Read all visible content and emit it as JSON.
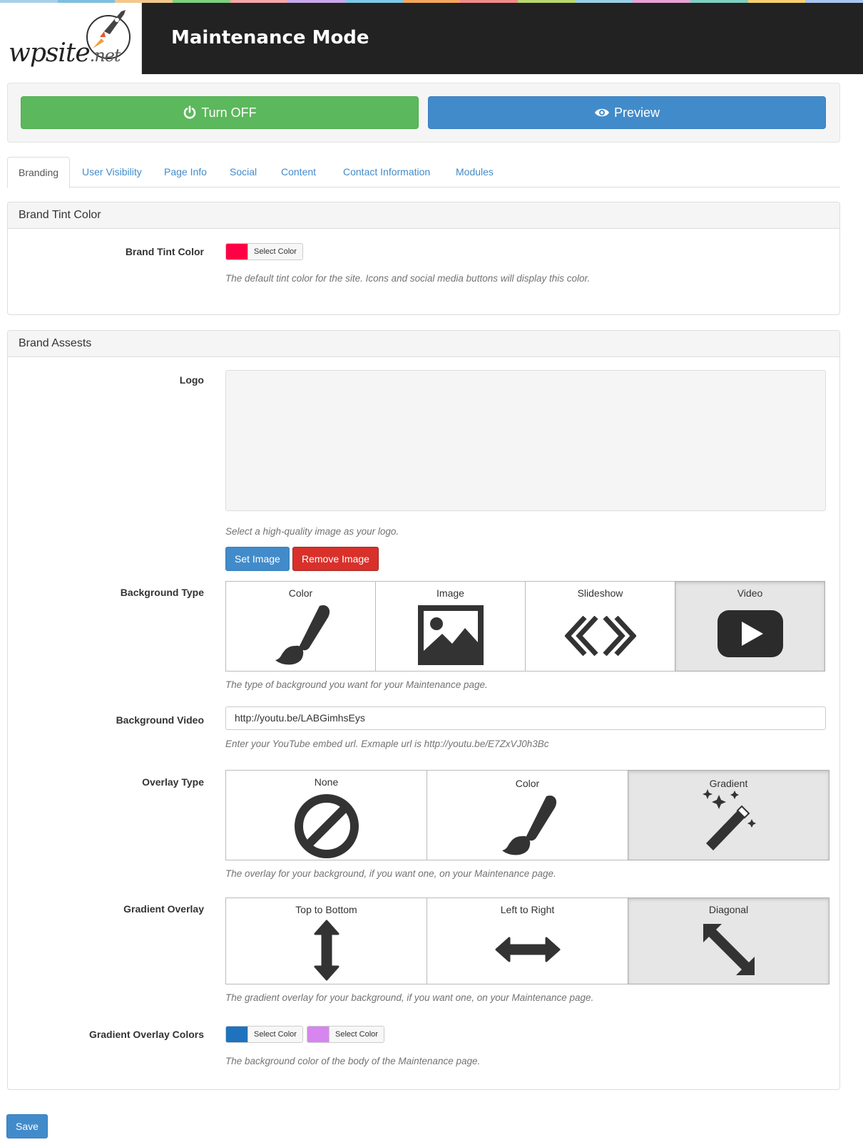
{
  "colors": {
    "rainbow": [
      "#a8d0e8",
      "#7ec0e0",
      "#f2c98a",
      "#7fd07f",
      "#f7a7a7",
      "#c9a8e8",
      "#7fc8e8",
      "#f5a65b",
      "#f28b8b",
      "#b9d86f",
      "#9ccfe6",
      "#e8a3d3",
      "#7fd0c0",
      "#f7d070",
      "#a9c6f0"
    ],
    "brand_tint": "#ff0044",
    "gradient_color_1": "#1e73be",
    "gradient_color_2": "#d686ee"
  },
  "header": {
    "logo_main": "wpsite",
    "logo_net": ".net",
    "title": "Maintenance Mode"
  },
  "actions": {
    "turn_off": "Turn OFF",
    "preview": "Preview",
    "turn_off_icon": "power-icon",
    "preview_icon": "eye-icon"
  },
  "tabs": [
    {
      "label": "Branding",
      "active": true
    },
    {
      "label": "User Visibility",
      "active": false
    },
    {
      "label": "Page Info",
      "active": false
    },
    {
      "label": "Social",
      "active": false
    },
    {
      "label": "Content",
      "active": false
    },
    {
      "label": "Contact Information",
      "active": false
    },
    {
      "label": "Modules",
      "active": false
    }
  ],
  "brand_tint_panel": {
    "heading": "Brand Tint Color",
    "label": "Brand Tint Color",
    "select_color": "Select Color",
    "help": "The default tint color for the site. Icons and social media buttons will display this color."
  },
  "brand_assets_panel": {
    "heading": "Brand Assests",
    "logo_label": "Logo",
    "logo_help": "Select a high-quality image as your logo.",
    "set_image": "Set Image",
    "remove_image": "Remove Image",
    "background_type": {
      "label": "Background Type",
      "options": [
        {
          "label": "Color",
          "icon": "paintbrush-icon",
          "selected": false
        },
        {
          "label": "Image",
          "icon": "image-icon",
          "selected": false
        },
        {
          "label": "Slideshow",
          "icon": "slideshow-chevrons-icon",
          "selected": false
        },
        {
          "label": "Video",
          "icon": "youtube-play-icon",
          "selected": true
        }
      ],
      "help": "The type of background you want for your Maintenance page."
    },
    "background_video": {
      "label": "Background Video",
      "value": "http://youtu.be/LABGimhsEys",
      "help": "Enter your YouTube embed url. Exmaple url is http://youtu.be/E7ZxVJ0h3Bc"
    },
    "overlay_type": {
      "label": "Overlay Type",
      "options": [
        {
          "label": "None",
          "icon": "ban-icon",
          "selected": false
        },
        {
          "label": "Color",
          "icon": "paintbrush-icon",
          "selected": false
        },
        {
          "label": "Gradient",
          "icon": "magic-wand-icon",
          "selected": true
        }
      ],
      "help": "The overlay for your background, if you want one, on your Maintenance page."
    },
    "gradient_overlay": {
      "label": "Gradient Overlay",
      "options": [
        {
          "label": "Top to Bottom",
          "icon": "vertical-arrows-icon",
          "selected": false
        },
        {
          "label": "Left to Right",
          "icon": "horizontal-arrows-icon",
          "selected": false
        },
        {
          "label": "Diagonal",
          "icon": "diagonal-arrows-icon",
          "selected": true
        }
      ],
      "help": "The gradient overlay for your background, if you want one, on your Maintenance page."
    },
    "gradient_colors": {
      "label": "Gradient Overlay Colors",
      "select_color_1": "Select Color",
      "select_color_2": "Select Color",
      "help": "The background color of the body of the Maintenance page."
    }
  },
  "save": "Save"
}
